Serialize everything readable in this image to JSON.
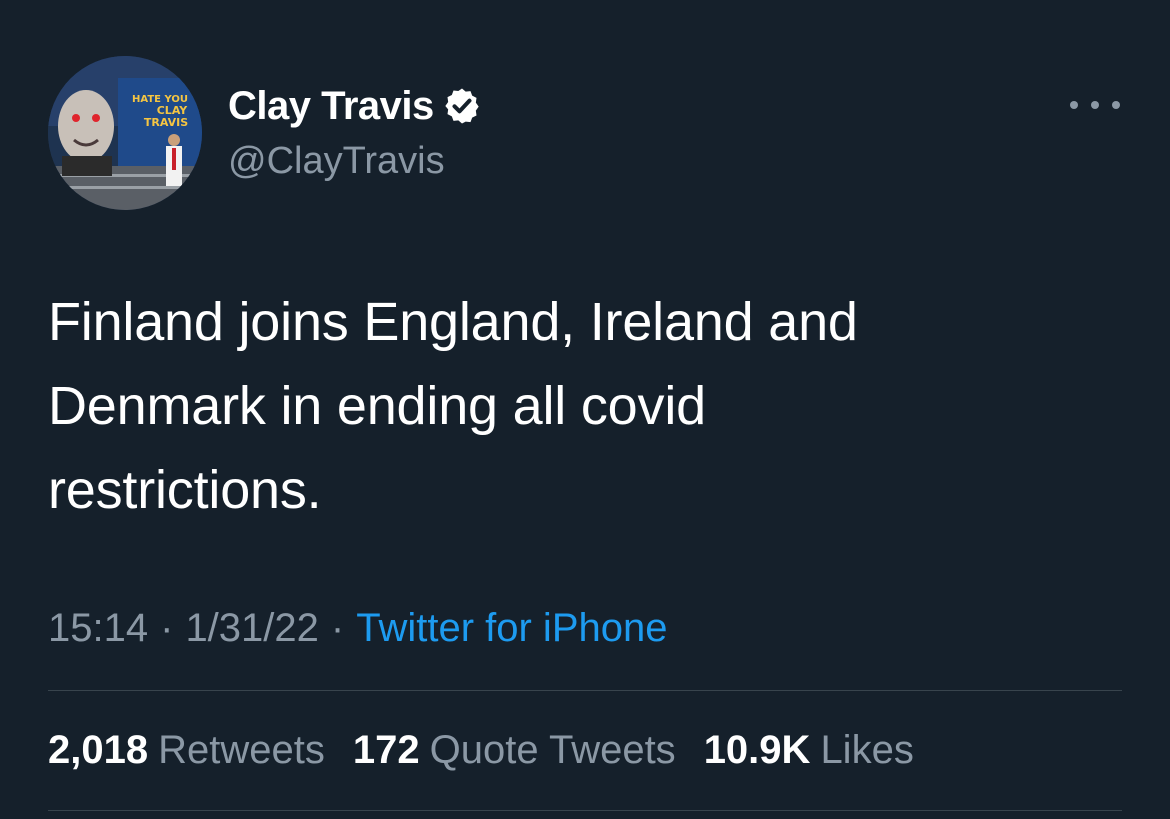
{
  "author": {
    "display_name": "Clay Travis",
    "handle": "@ClayTravis",
    "verified": true,
    "avatar_sign_text": "\"I HATE YOU CLAY TRAVIS\""
  },
  "tweet": {
    "lines": [
      "Finland joins England, Ireland and",
      "Denmark in ending all covid",
      "restrictions."
    ]
  },
  "meta": {
    "time": "15:14",
    "separator": "·",
    "date": "1/31/22",
    "source": "Twitter for iPhone"
  },
  "stats": {
    "retweets_count": "2,018",
    "retweets_label": "Retweets",
    "quotes_count": "172",
    "quotes_label": "Quote Tweets",
    "likes_count": "10.9K",
    "likes_label": "Likes"
  },
  "colors": {
    "background": "#15202b",
    "link": "#1d9bf0",
    "secondary_text": "#8b98a5",
    "divider": "#38444d"
  },
  "icons": {
    "verified": "verified-badge-icon",
    "more": "more-options-icon"
  }
}
